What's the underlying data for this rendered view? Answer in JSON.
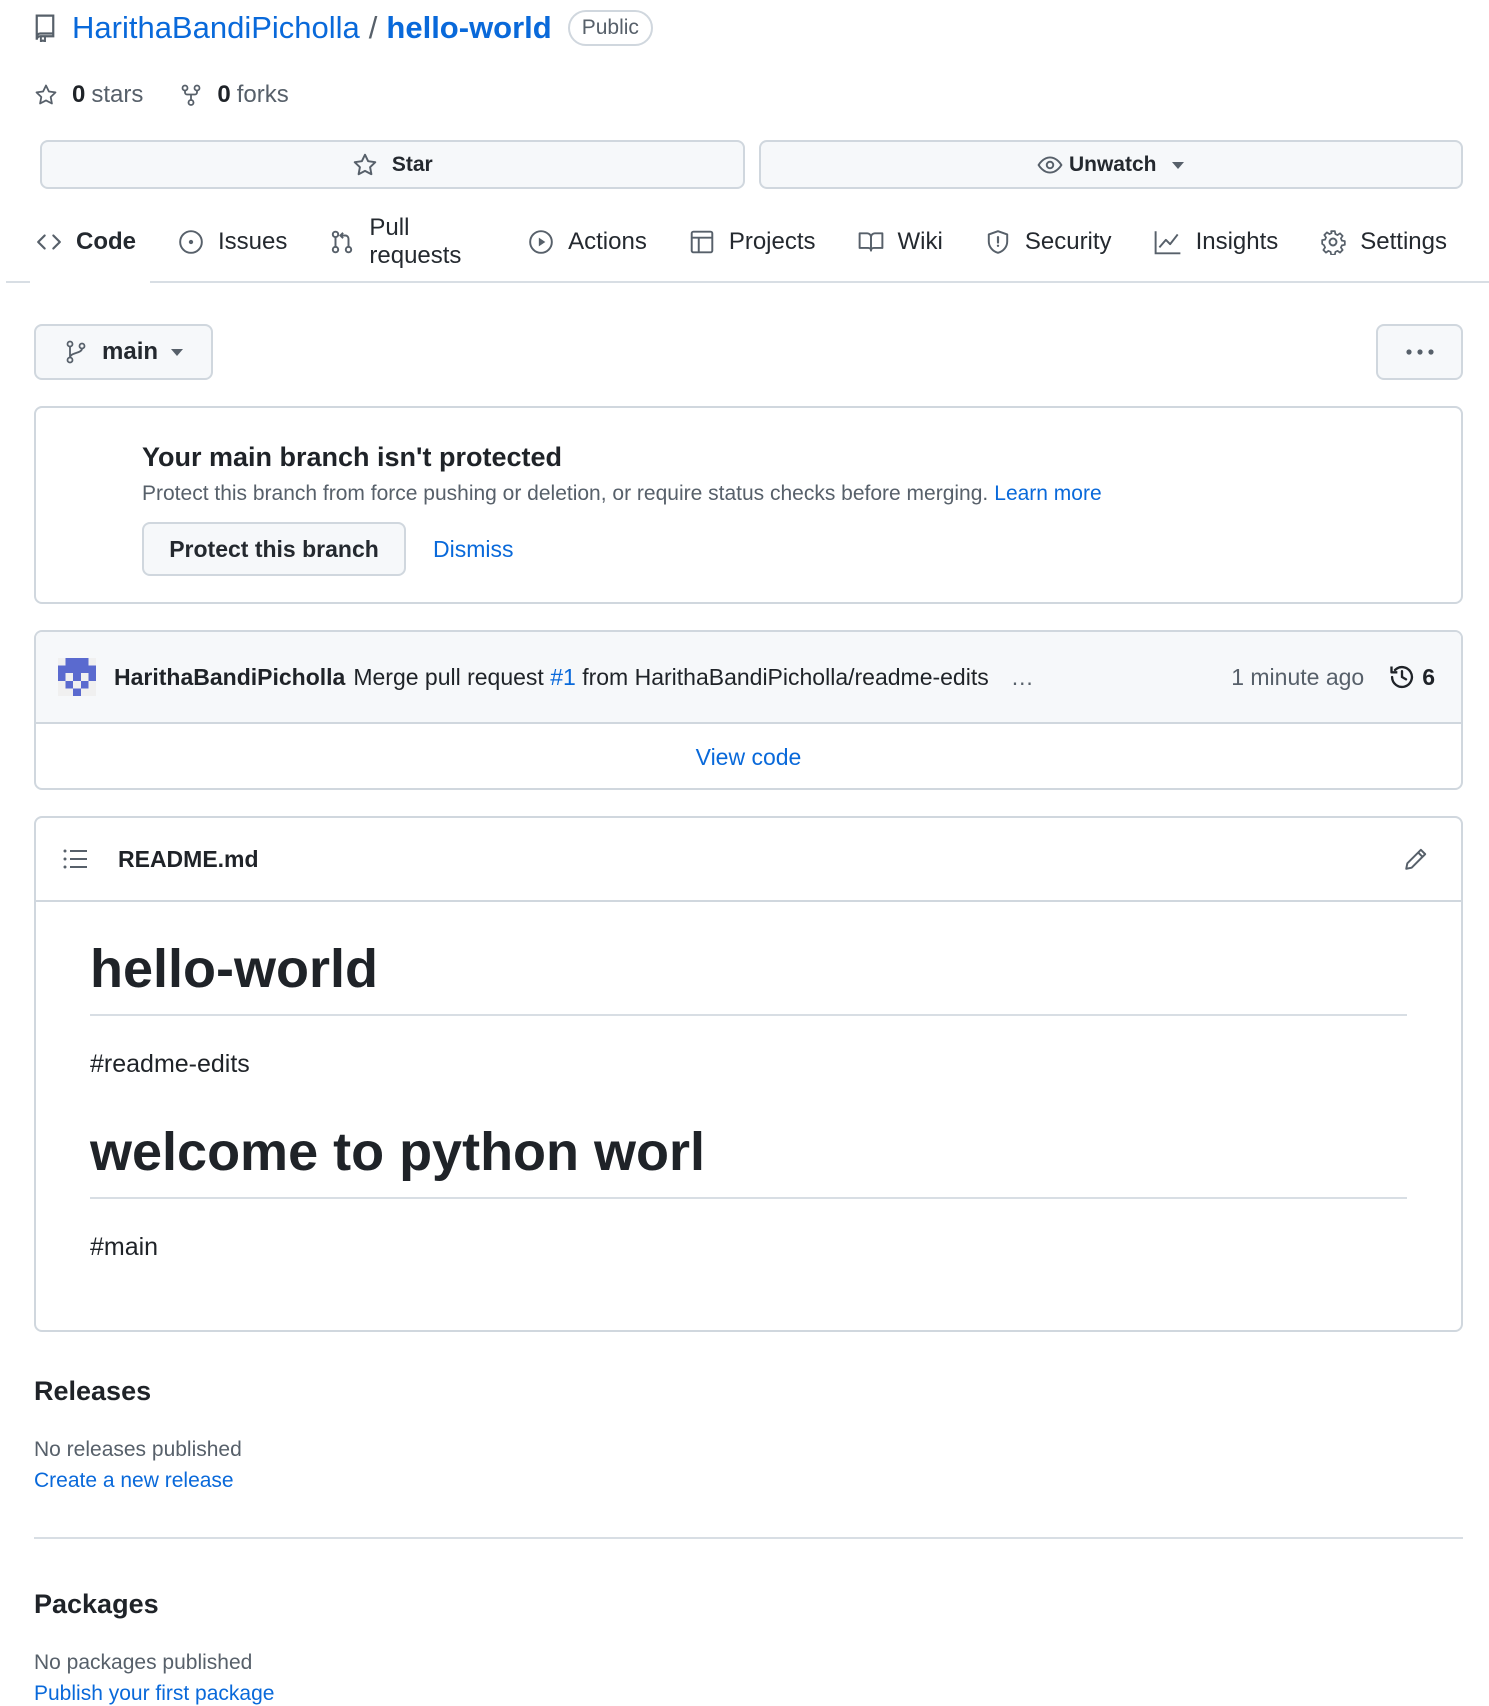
{
  "repo": {
    "owner": "HarithaBandiPicholla",
    "separator": "/",
    "name": "hello-world",
    "visibility": "Public",
    "stars_count": "0",
    "stars_label": "stars",
    "forks_count": "0",
    "forks_label": "forks"
  },
  "actions": {
    "star_label": "Star",
    "watch_label": "Unwatch"
  },
  "nav": {
    "code": "Code",
    "issues": "Issues",
    "pull_requests": "Pull requests",
    "actions": "Actions",
    "projects": "Projects",
    "wiki": "Wiki",
    "security": "Security",
    "insights": "Insights",
    "settings": "Settings"
  },
  "branch": {
    "current": "main"
  },
  "protect_notice": {
    "title": "Your main branch isn't protected",
    "text": "Protect this branch from force pushing or deletion, or require status checks before merging.",
    "learn_more": "Learn more",
    "protect_button": "Protect this branch",
    "dismiss": "Dismiss"
  },
  "commit": {
    "author": "HarithaBandiPicholla",
    "message_before": "Merge pull request ",
    "pr_link": "#1",
    "message_after": " from HarithaBandiPicholla/readme-edits",
    "ellipsis": "…",
    "time": "1 minute ago",
    "count": "6",
    "view_code": "View code"
  },
  "readme": {
    "filename": "README.md",
    "heading1": "hello-world",
    "paragraph1": "#readme-edits",
    "heading2": "welcome to python worl",
    "paragraph2": "#main"
  },
  "releases": {
    "title": "Releases",
    "empty_text": "No releases published",
    "create_link": "Create a new release"
  },
  "packages": {
    "title": "Packages",
    "empty_text": "No packages published",
    "publish_link": "Publish your first package"
  },
  "colors": {
    "link": "#0969da",
    "text": "#1f2328",
    "muted": "#57606a",
    "border": "#d0d7de",
    "avatar": "#5a6acf"
  }
}
